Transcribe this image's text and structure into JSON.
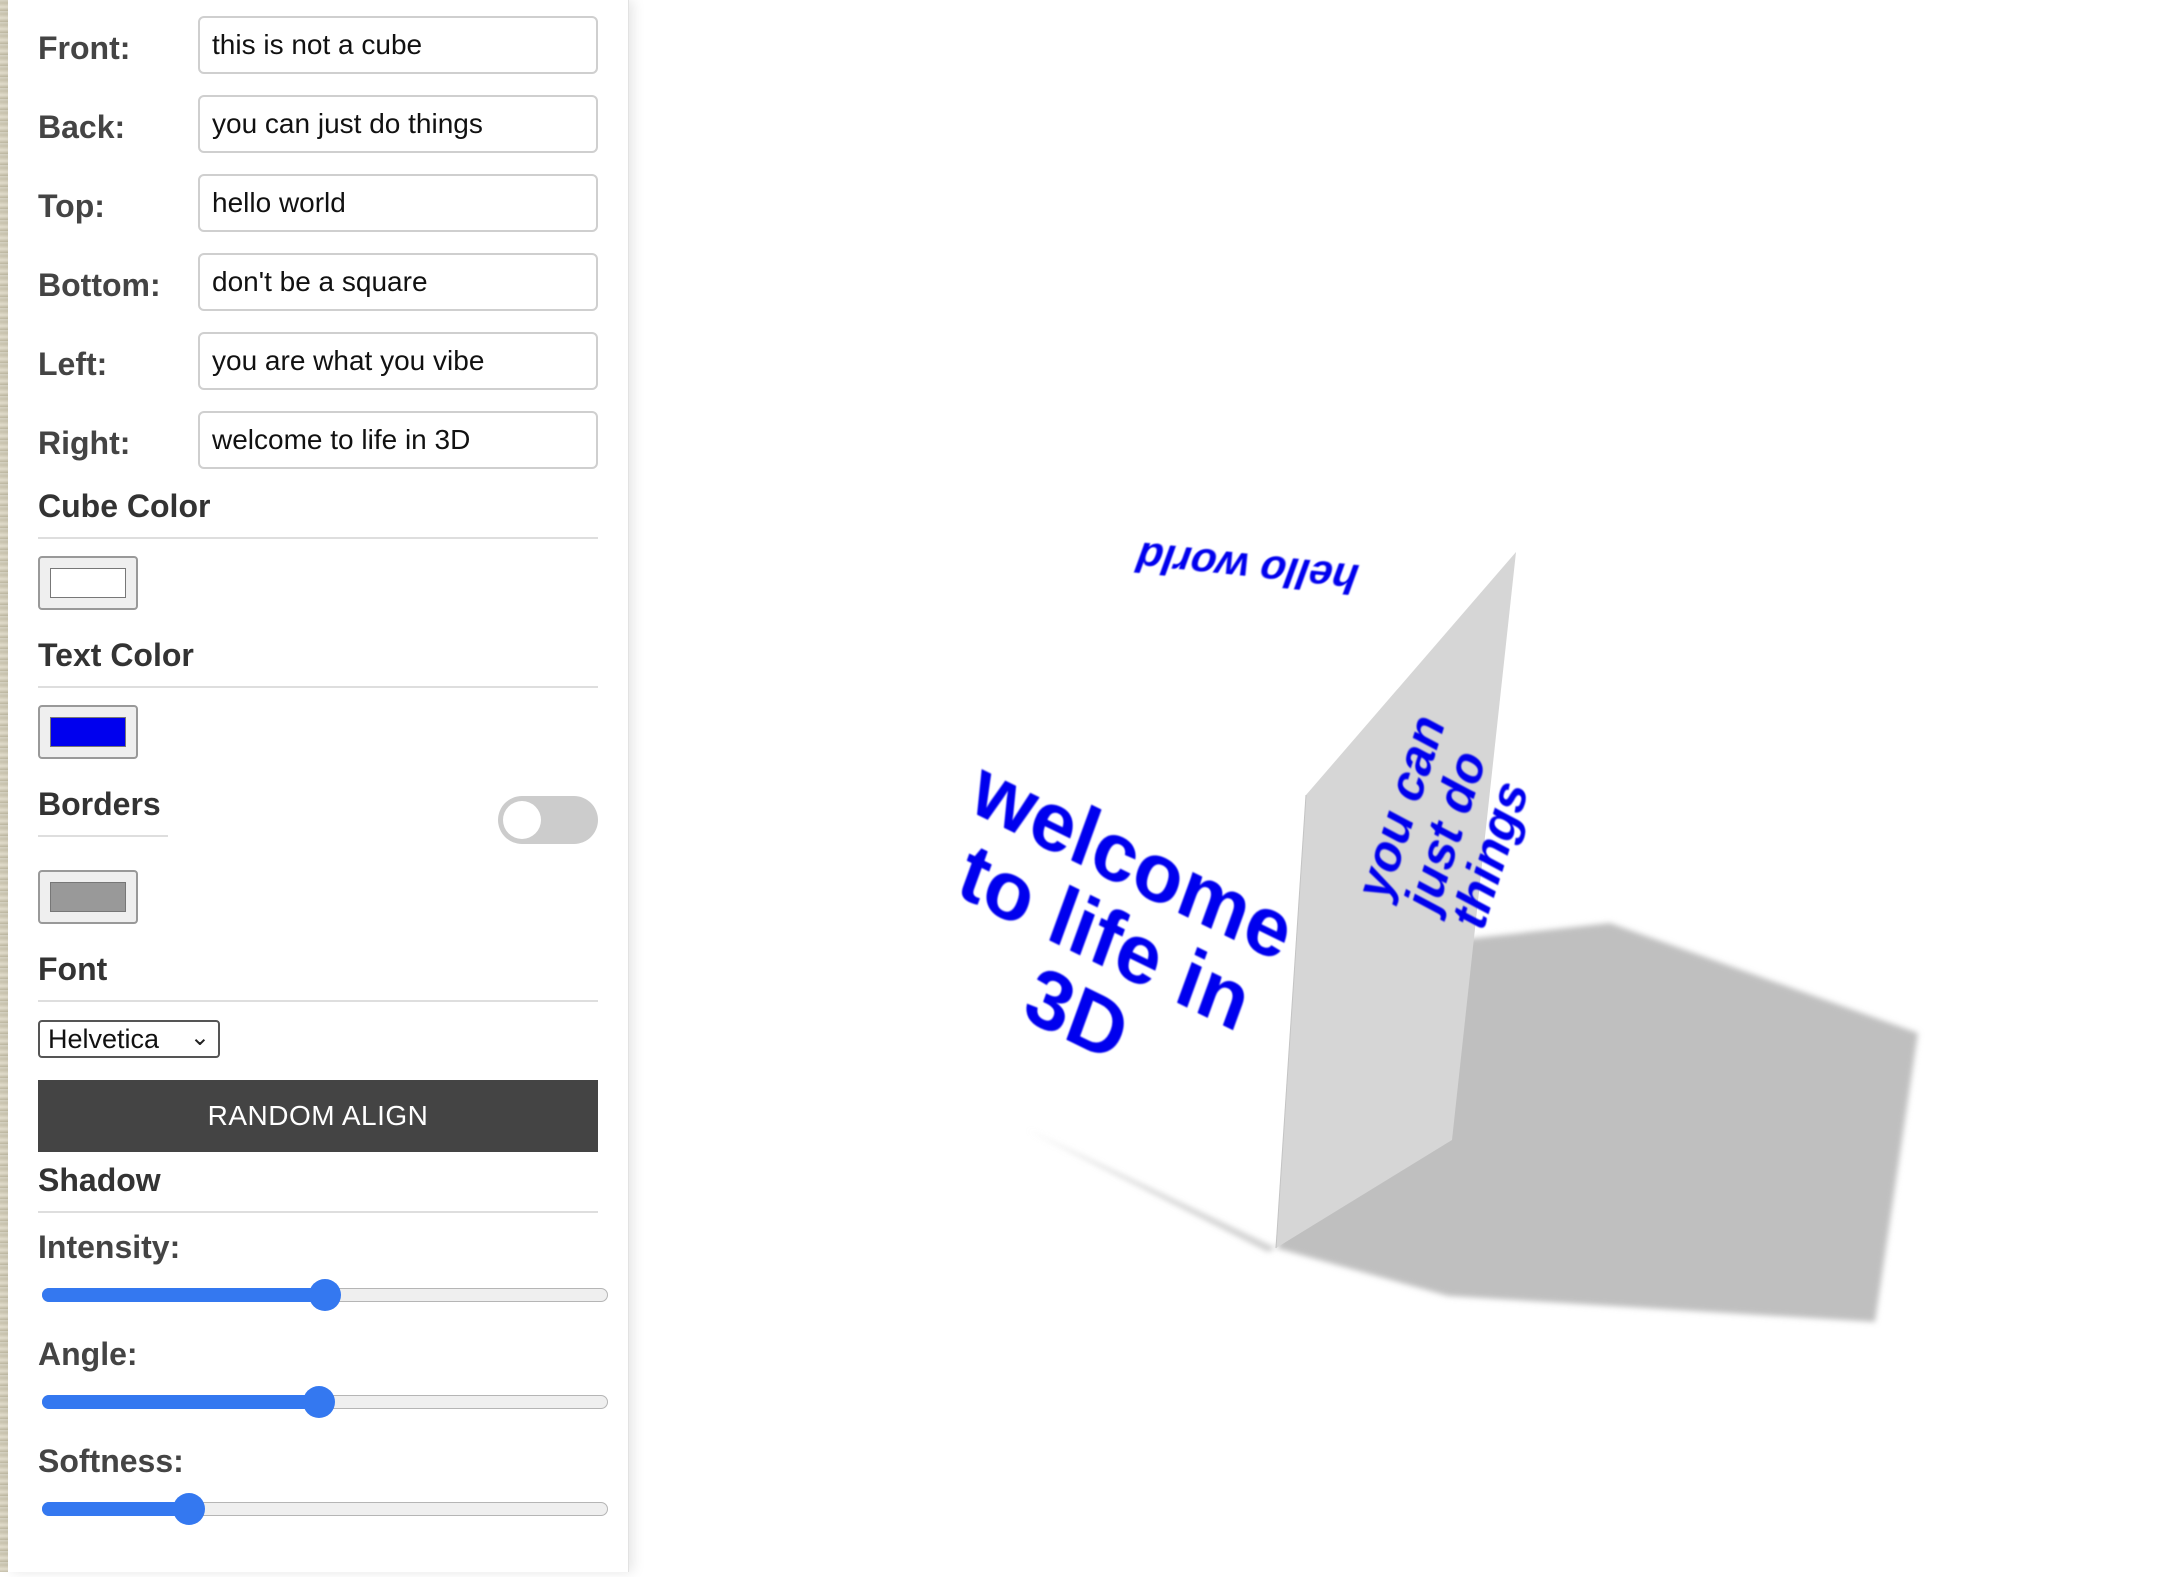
{
  "faces": [
    {
      "label": "Front:",
      "value": "this is not a cube"
    },
    {
      "label": "Back:",
      "value": "you can just do things"
    },
    {
      "label": "Top:",
      "value": "hello world"
    },
    {
      "label": "Bottom:",
      "value": "don't be a square"
    },
    {
      "label": "Left:",
      "value": "you are what you vibe"
    },
    {
      "label": "Right:",
      "value": "welcome to life in 3D"
    }
  ],
  "cube_color": {
    "title": "Cube Color",
    "value": "#ffffff"
  },
  "text_color": {
    "title": "Text Color",
    "value": "#0000ee"
  },
  "borders": {
    "title": "Borders",
    "enabled": false,
    "color": "#999999"
  },
  "font": {
    "title": "Font",
    "selected": "Helvetica"
  },
  "random_align": {
    "label": "RANDOM ALIGN"
  },
  "shadow": {
    "title": "Shadow",
    "sliders": [
      {
        "label": "Intensity:",
        "fraction": 0.5
      },
      {
        "label": "Angle:",
        "fraction": 0.49
      },
      {
        "label": "Softness:",
        "fraction": 0.26
      }
    ]
  },
  "scene": {
    "top_text": "hello world",
    "side_text_lines": [
      "welcome",
      "to life in",
      "3D"
    ],
    "back_text_lines": [
      "you can",
      "just do",
      "things"
    ]
  }
}
